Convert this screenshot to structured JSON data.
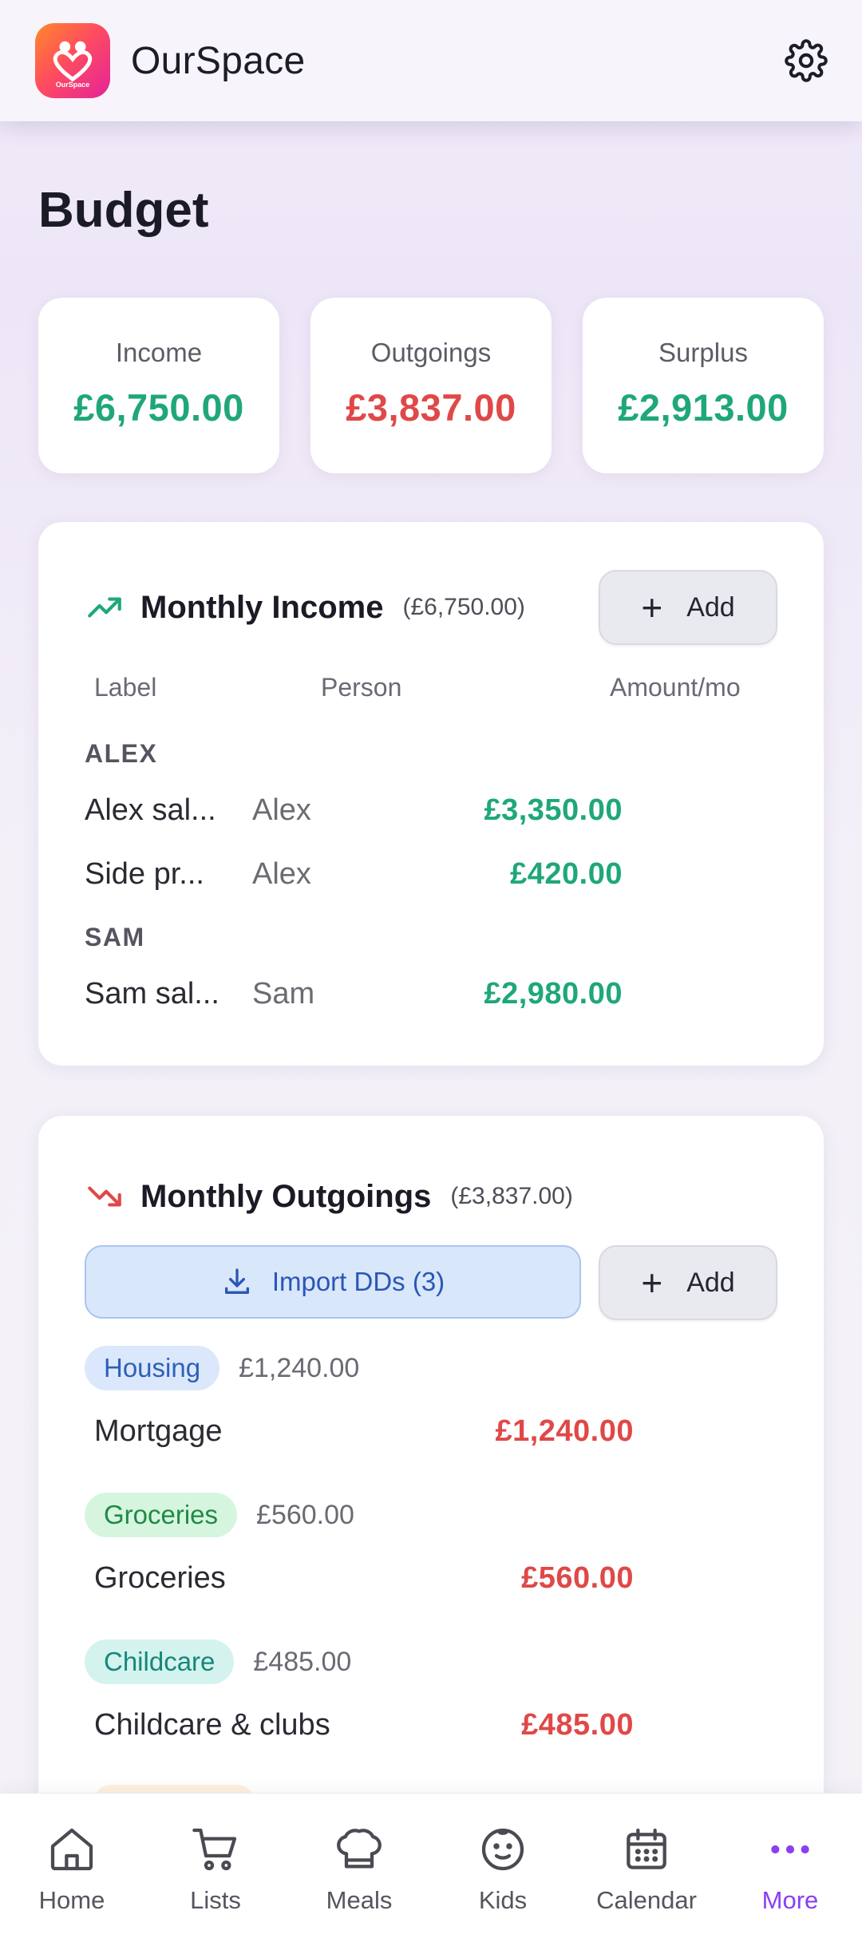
{
  "app": {
    "title": "OurSpace",
    "logo_text": "OurSpace"
  },
  "page": {
    "title": "Budget"
  },
  "summary": [
    {
      "label": "Income",
      "value": "£6,750.00",
      "color": "#1fa77a"
    },
    {
      "label": "Outgoings",
      "value": "£3,837.00",
      "color": "#e04848"
    },
    {
      "label": "Surplus",
      "value": "£2,913.00",
      "color": "#1fa77a"
    }
  ],
  "income": {
    "title": "Monthly Income",
    "total": "(£6,750.00)",
    "add_label": "Add",
    "columns": {
      "label": "Label",
      "person": "Person",
      "amount": "Amount/mo"
    },
    "groups": [
      {
        "name": "ALEX",
        "rows": [
          {
            "label": "Alex sal...",
            "person": "Alex",
            "amount": "£3,350.00"
          },
          {
            "label": "Side pr...",
            "person": "Alex",
            "amount": "£420.00"
          }
        ]
      },
      {
        "name": "SAM",
        "rows": [
          {
            "label": "Sam sal...",
            "person": "Sam",
            "amount": "£2,980.00"
          }
        ]
      }
    ]
  },
  "outgoings": {
    "title": "Monthly Outgoings",
    "total": "(£3,837.00)",
    "import_label": "Import DDs (3)",
    "add_label": "Add",
    "categories": [
      {
        "tag": "Housing",
        "tag_total": "£1,240.00",
        "item": "Mortgage",
        "amount": "£1,240.00"
      },
      {
        "tag": "Groceries",
        "tag_total": "£560.00",
        "item": "Groceries",
        "amount": "£560.00"
      },
      {
        "tag": "Childcare",
        "tag_total": "£485.00",
        "item": "Childcare & clubs",
        "amount": "£485.00"
      }
    ]
  },
  "nav": [
    {
      "label": "Home",
      "icon": "home-icon"
    },
    {
      "label": "Lists",
      "icon": "cart-icon"
    },
    {
      "label": "Meals",
      "icon": "chef-hat-icon"
    },
    {
      "label": "Kids",
      "icon": "face-icon"
    },
    {
      "label": "Calendar",
      "icon": "calendar-icon"
    },
    {
      "label": "More",
      "icon": "more-dots-icon",
      "active": true
    }
  ],
  "colors": {
    "accent": "#8a3ff0",
    "income": "#1fa77a",
    "outgoing": "#e04848"
  }
}
